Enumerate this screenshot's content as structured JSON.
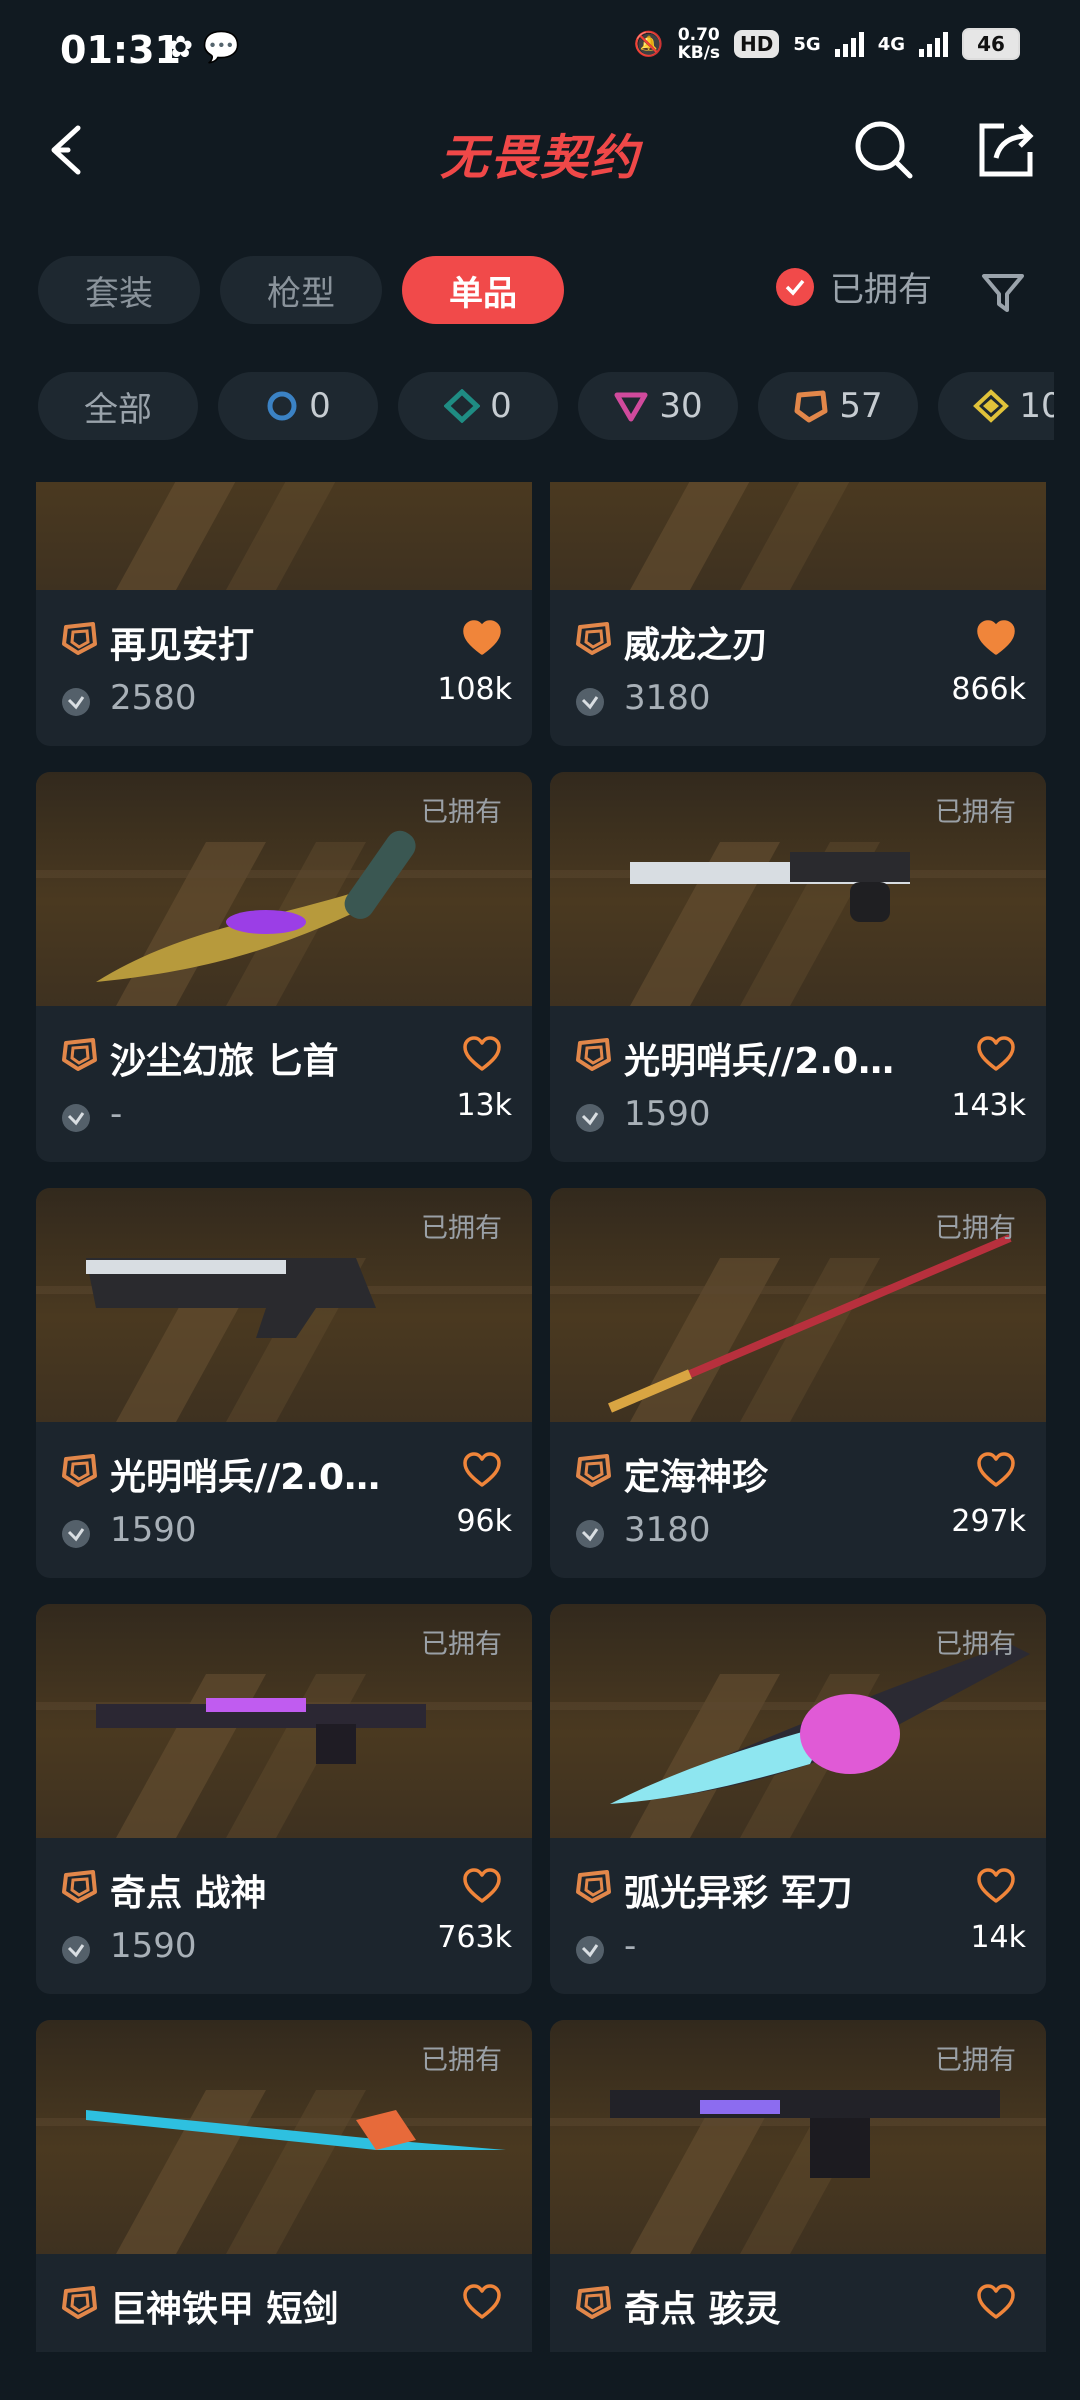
{
  "status_bar": {
    "time": "01:31",
    "net_speed": "0.70",
    "net_unit": "KB/s",
    "hd": "HD",
    "sig1": "5G",
    "sig2": "4G",
    "battery": "46"
  },
  "header": {
    "title": "无畏契约"
  },
  "tabs": [
    {
      "label": "套装"
    },
    {
      "label": "枪型"
    },
    {
      "label": "单品"
    }
  ],
  "owned_filter": {
    "label": "已拥有"
  },
  "chips": [
    {
      "label": "全部",
      "count": ""
    },
    {
      "label": "",
      "count": "0",
      "icon": "blue-circle-icon",
      "color": "#3b82c4"
    },
    {
      "label": "",
      "count": "0",
      "icon": "teal-diamond-icon",
      "color": "#1f8c83"
    },
    {
      "label": "",
      "count": "30",
      "icon": "pink-triangle-icon",
      "color": "#d04a9c"
    },
    {
      "label": "",
      "count": "57",
      "icon": "orange-pentagon-icon",
      "color": "#e2874a"
    },
    {
      "label": "",
      "count": "10",
      "icon": "yellow-diamond-icon",
      "color": "#e0c23a"
    }
  ],
  "items": [
    {
      "name": "再见安打",
      "price": "2580",
      "likes": "108k",
      "owned": "",
      "liked": true
    },
    {
      "name": "威龙之刃",
      "price": "3180",
      "likes": "866k",
      "owned": "",
      "liked": true
    },
    {
      "name": "沙尘幻旅 匕首",
      "price": "-",
      "likes": "13k",
      "owned": "已拥有",
      "liked": false
    },
    {
      "name": "光明哨兵//2.0…",
      "price": "1590",
      "likes": "143k",
      "owned": "已拥有",
      "liked": false
    },
    {
      "name": "光明哨兵//2.0…",
      "price": "1590",
      "likes": "96k",
      "owned": "已拥有",
      "liked": false
    },
    {
      "name": "定海神珍",
      "price": "3180",
      "likes": "297k",
      "owned": "已拥有",
      "liked": false
    },
    {
      "name": "奇点 战神",
      "price": "1590",
      "likes": "763k",
      "owned": "已拥有",
      "liked": false
    },
    {
      "name": "弧光异彩 军刀",
      "price": "-",
      "likes": "14k",
      "owned": "已拥有",
      "liked": false
    },
    {
      "name": "巨神铁甲 短剑",
      "price": "",
      "likes": "",
      "owned": "已拥有",
      "liked": false
    },
    {
      "name": "奇点 骇灵",
      "price": "",
      "likes": "",
      "owned": "已拥有",
      "liked": false
    }
  ],
  "colors": {
    "accent": "#f14a4a",
    "tier_orange": "#e2874a",
    "background": "#111a21",
    "card": "#1c252d"
  }
}
